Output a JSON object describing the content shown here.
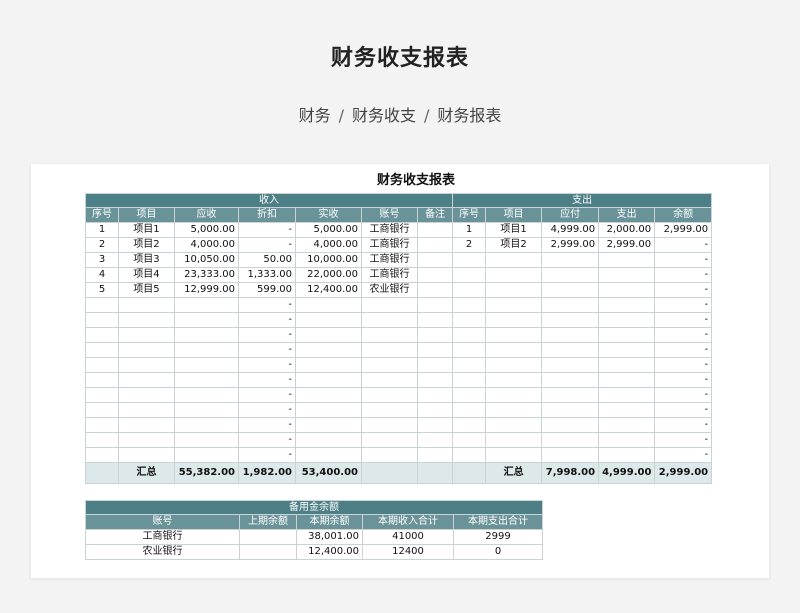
{
  "page": {
    "title": "财务收支报表"
  },
  "breadcrumb": [
    "财务",
    "财务收支",
    "财务报表"
  ],
  "sheet": {
    "title": "财务收支报表",
    "income": {
      "group_label": "收入",
      "headers": [
        "序号",
        "项目",
        "应收",
        "折扣",
        "实收",
        "账号",
        "备注"
      ],
      "rows": [
        [
          "1",
          "项目1",
          "5,000.00",
          "-",
          "5,000.00",
          "工商银行",
          ""
        ],
        [
          "2",
          "项目2",
          "4,000.00",
          "-",
          "4,000.00",
          "工商银行",
          ""
        ],
        [
          "3",
          "项目3",
          "10,050.00",
          "50.00",
          "10,000.00",
          "工商银行",
          ""
        ],
        [
          "4",
          "项目4",
          "23,333.00",
          "1,333.00",
          "22,000.00",
          "工商银行",
          ""
        ],
        [
          "5",
          "项目5",
          "12,999.00",
          "599.00",
          "12,400.00",
          "农业银行",
          ""
        ],
        [
          "",
          "",
          "",
          "-",
          "",
          "",
          ""
        ],
        [
          "",
          "",
          "",
          "-",
          "",
          "",
          ""
        ],
        [
          "",
          "",
          "",
          "-",
          "",
          "",
          ""
        ],
        [
          "",
          "",
          "",
          "-",
          "",
          "",
          ""
        ],
        [
          "",
          "",
          "",
          "-",
          "",
          "",
          ""
        ],
        [
          "",
          "",
          "",
          "-",
          "",
          "",
          ""
        ],
        [
          "",
          "",
          "",
          "-",
          "",
          "",
          ""
        ],
        [
          "",
          "",
          "",
          "-",
          "",
          "",
          ""
        ],
        [
          "",
          "",
          "",
          "-",
          "",
          "",
          ""
        ],
        [
          "",
          "",
          "",
          "-",
          "",
          "",
          ""
        ],
        [
          "",
          "",
          "",
          "-",
          "",
          "",
          ""
        ]
      ],
      "total": {
        "label": "汇总",
        "receivable": "55,382.00",
        "discount": "1,982.00",
        "received": "53,400.00"
      }
    },
    "expense": {
      "group_label": "支出",
      "headers": [
        "序号",
        "项目",
        "应付",
        "支出",
        "余额"
      ],
      "rows": [
        [
          "1",
          "项目1",
          "4,999.00",
          "2,000.00",
          "2,999.00"
        ],
        [
          "2",
          "项目2",
          "2,999.00",
          "2,999.00",
          "-"
        ],
        [
          "",
          "",
          "",
          "",
          "-"
        ],
        [
          "",
          "",
          "",
          "",
          "-"
        ],
        [
          "",
          "",
          "",
          "",
          "-"
        ],
        [
          "",
          "",
          "",
          "",
          "-"
        ],
        [
          "",
          "",
          "",
          "",
          "-"
        ],
        [
          "",
          "",
          "",
          "",
          "-"
        ],
        [
          "",
          "",
          "",
          "",
          "-"
        ],
        [
          "",
          "",
          "",
          "",
          "-"
        ],
        [
          "",
          "",
          "",
          "",
          "-"
        ],
        [
          "",
          "",
          "",
          "",
          "-"
        ],
        [
          "",
          "",
          "",
          "",
          "-"
        ],
        [
          "",
          "",
          "",
          "",
          "-"
        ],
        [
          "",
          "",
          "",
          "",
          "-"
        ],
        [
          "",
          "",
          "",
          "",
          "-"
        ]
      ],
      "total": {
        "label": "汇总",
        "payable": "7,998.00",
        "paid": "4,999.00",
        "balance": "2,999.00"
      }
    },
    "reserve": {
      "group_label": "备用金余额",
      "headers": [
        "账号",
        "上期余额",
        "本期余额",
        "本期收入合计",
        "本期支出合计"
      ],
      "rows": [
        [
          "工商银行",
          "",
          "38,001.00",
          "41000",
          "2999"
        ],
        [
          "农业银行",
          "",
          "12,400.00",
          "12400",
          "0"
        ]
      ]
    }
  }
}
